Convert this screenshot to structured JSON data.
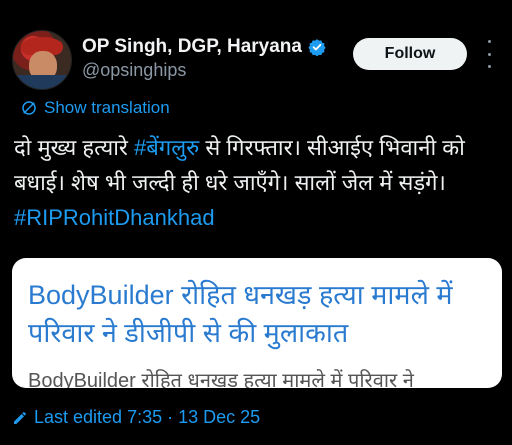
{
  "author": {
    "display_name": "OP Singh, DGP, Haryana",
    "handle": "@opsinghips",
    "verified": true
  },
  "actions": {
    "follow_label": "Follow",
    "more_icon": "more-icon"
  },
  "translation": {
    "label": "Show translation",
    "icon": "globe-icon"
  },
  "tweet": {
    "line1_a": "दो मुख्य हत्यारे ",
    "line1_hashtag": "#बेंगलुरु",
    "line1_b": " से गिरफ्तार। सीआईए भिवानी को बधाई। शेष भी जल्दी ही धरे जाएँगे। सालों जेल में सड़ंगे।",
    "hashtag2": "#RIPRohitDhankhad"
  },
  "card": {
    "title": "BodyBuilder रोहित धनखड़ हत्या मामले में परिवार ने डीजीपी से की मुलाकात",
    "subtitle": "BodyBuilder रोहित धनखड़ हत्या मामले में परिवार ने"
  },
  "footer": {
    "edited_label": "Last edited 7:35 · 13 Dec 25",
    "icon": "pencil-icon"
  },
  "colors": {
    "accent": "#1d9bf0",
    "background": "#000000",
    "card_title": "#2a7bd0"
  }
}
